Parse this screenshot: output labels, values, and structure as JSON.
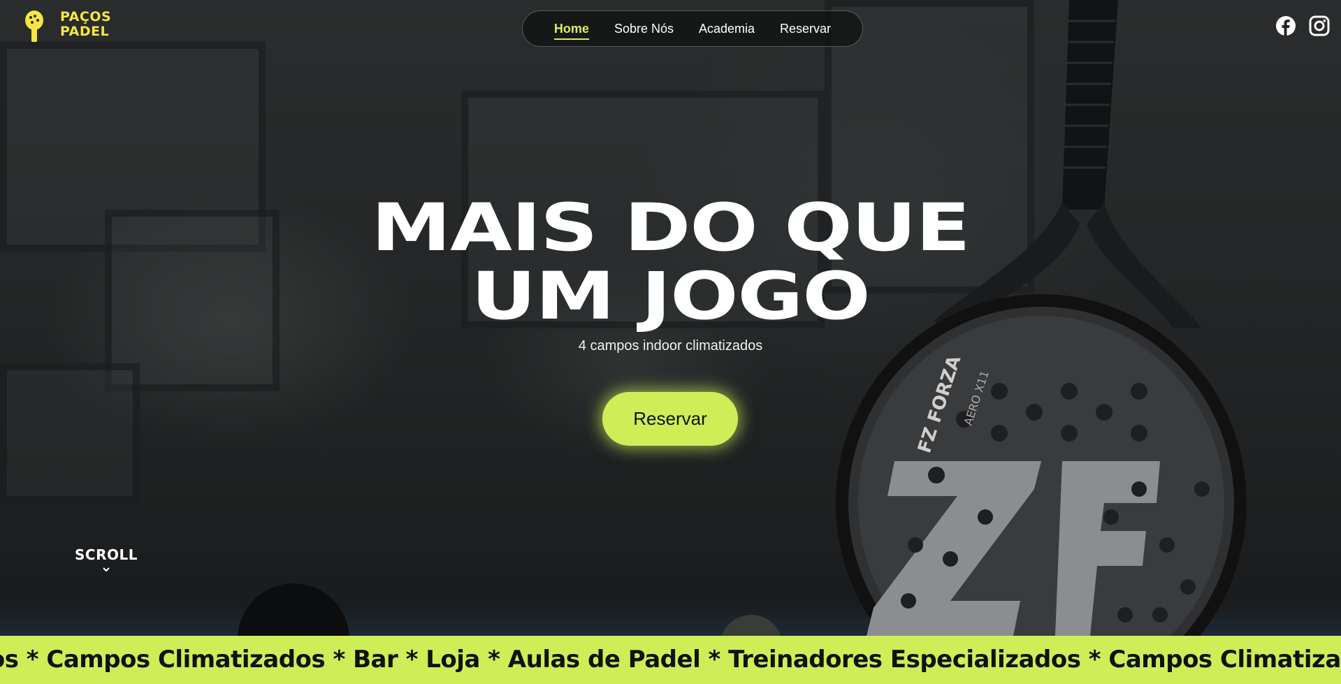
{
  "brand": {
    "logo_line1": "PAÇOS",
    "logo_line2": "PADEL",
    "logo_icon": "padel-racket-logo-icon",
    "accent_color": "#cdee57",
    "logo_color": "#f5e642"
  },
  "nav": {
    "items": [
      {
        "label": "Home",
        "active": true
      },
      {
        "label": "Sobre Nós",
        "active": false
      },
      {
        "label": "Academia",
        "active": false
      },
      {
        "label": "Reservar",
        "active": false
      }
    ]
  },
  "social": {
    "facebook_icon": "facebook-icon",
    "instagram_icon": "instagram-icon"
  },
  "hero": {
    "title_line1": "MAIS DO QUE",
    "title_line2": "UM JOGO",
    "subtitle": "4 campos indoor climatizados",
    "cta_label": "Reservar"
  },
  "scroll": {
    "label": "SCROLL",
    "icon": "chevron-down-icon"
  },
  "racket": {
    "brand_text": "FZ FORZA",
    "model_text": "AERO X11"
  },
  "marquee": {
    "text": "dos * Campos Climatizados * Bar * Loja * Aulas de Padel * Treinadores Especializados * Campos Climatiza"
  }
}
